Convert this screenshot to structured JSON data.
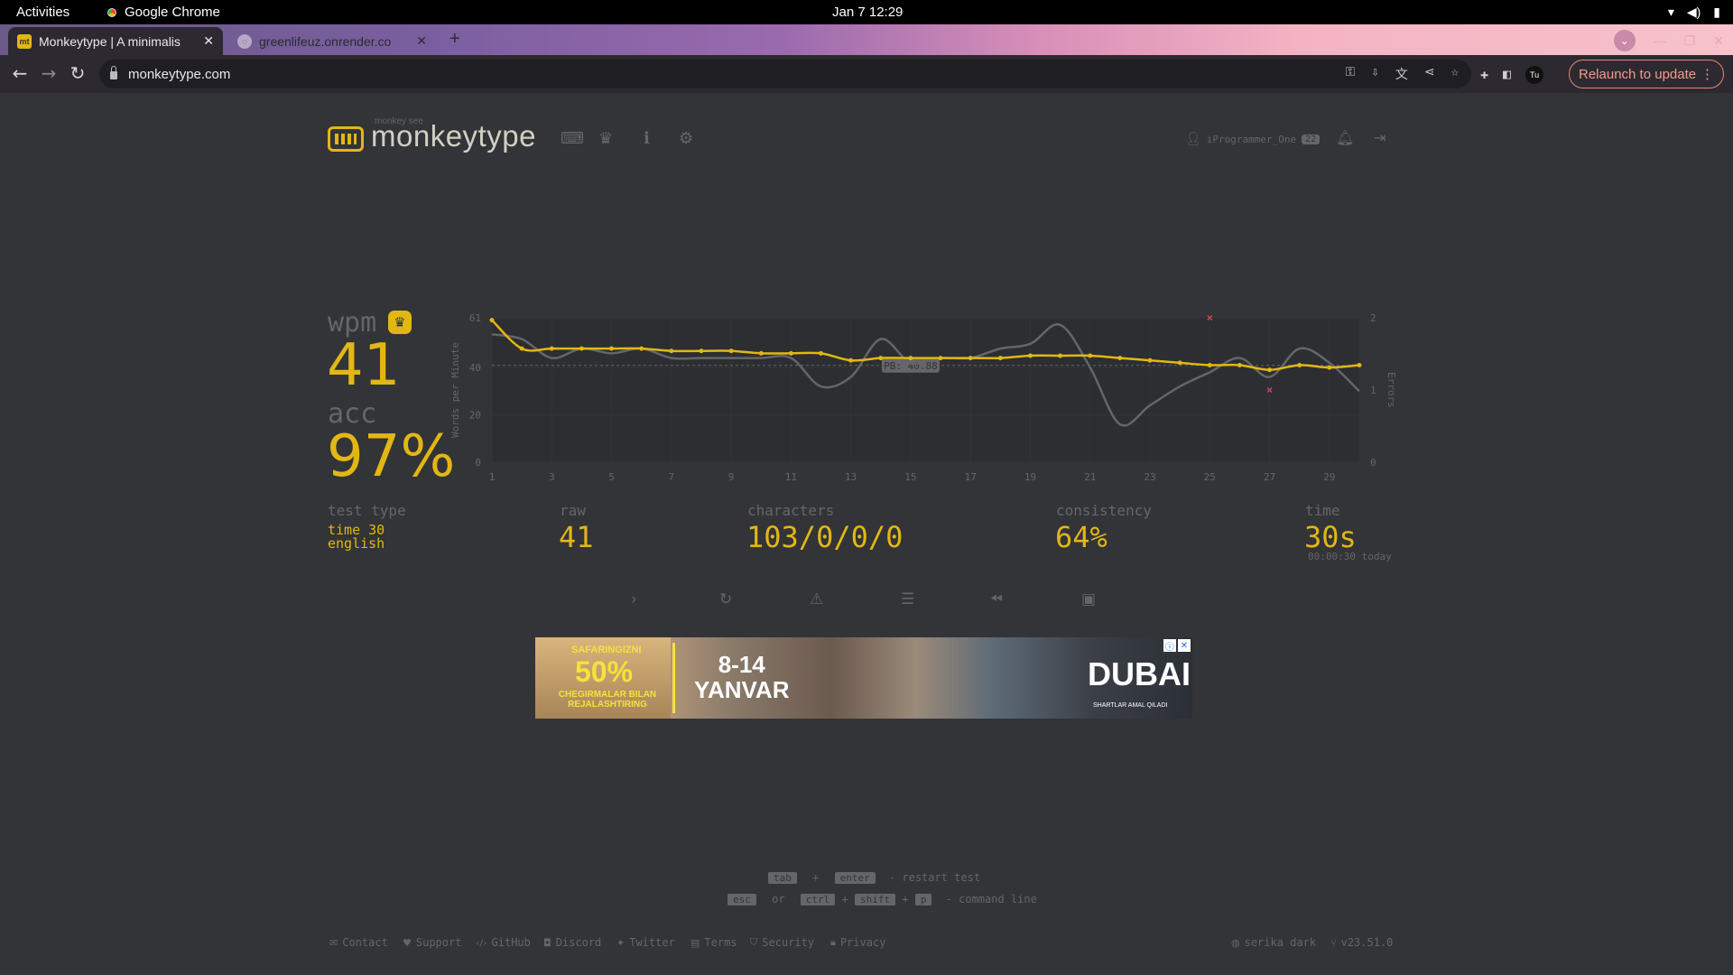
{
  "system": {
    "activities": "Activities",
    "app_name": "Google Chrome",
    "clock": "Jan 7  12:29",
    "tray_icons": [
      "wifi-icon",
      "volume-icon",
      "battery-icon"
    ]
  },
  "browser": {
    "tabs": [
      {
        "title": "Monkeytype | A minimalis",
        "favicon": "mt",
        "active": true
      },
      {
        "title": "greenlifeuz.onrender.co",
        "favicon": "",
        "active": false
      }
    ],
    "new_tab": "+",
    "url": "monkeytype.com",
    "relaunch_label": "Relaunch to update",
    "profile_initials": "Tu"
  },
  "header": {
    "logo_top": "monkey see",
    "logo_text": "monkeytype",
    "username": "iProgrammer_One",
    "level": "22"
  },
  "stats": {
    "wpm_label": "wpm",
    "wpm": "41",
    "acc_label": "acc",
    "acc": "97%",
    "test_type_label": "test type",
    "test_type_line1": "time 30",
    "test_type_line2": "english",
    "raw_label": "raw",
    "raw": "41",
    "characters_label": "characters",
    "characters": "103/0/0/0",
    "consistency_label": "consistency",
    "consistency": "64%",
    "time_label": "time",
    "time": "30s",
    "time_detail": "00:00:30 today"
  },
  "chart_data": {
    "type": "line",
    "ylabel": "Words per Minute",
    "y2label": "Errors",
    "x": [
      1,
      2,
      3,
      4,
      5,
      6,
      7,
      8,
      9,
      10,
      11,
      12,
      13,
      14,
      15,
      16,
      17,
      18,
      19,
      20,
      21,
      22,
      23,
      24,
      25,
      26,
      27,
      28,
      29,
      30
    ],
    "x_ticks": [
      1,
      3,
      5,
      7,
      9,
      11,
      13,
      15,
      17,
      19,
      21,
      23,
      25,
      27,
      29
    ],
    "y_ticks": [
      0,
      20,
      40,
      61
    ],
    "y2_ticks": [
      0,
      1,
      2
    ],
    "ylim": [
      0,
      61
    ],
    "y2lim": [
      0,
      2
    ],
    "pb_label": "PB: 40.88",
    "pb_value": 40.88,
    "series": [
      {
        "name": "wpm",
        "color": "#e2b714",
        "values": [
          60,
          48,
          48,
          48,
          48,
          48,
          47,
          47,
          47,
          46,
          46,
          46,
          43,
          44,
          44,
          44,
          44,
          44,
          45,
          45,
          45,
          44,
          43,
          42,
          41,
          41,
          39,
          41,
          40,
          41
        ]
      },
      {
        "name": "raw",
        "color": "#646669",
        "values": [
          54,
          52,
          44,
          48,
          46,
          48,
          44,
          44,
          44,
          44,
          44,
          32,
          36,
          52,
          42,
          44,
          44,
          48,
          50,
          58,
          40,
          16,
          24,
          32,
          38,
          44,
          36,
          48,
          42,
          30
        ]
      }
    ],
    "errors": [
      {
        "x": 25,
        "y": 2
      },
      {
        "x": 27,
        "y": 1
      }
    ]
  },
  "actions": [
    "next-test-icon",
    "restart-icon",
    "report-icon",
    "words-history-icon",
    "replay-icon",
    "screenshot-icon"
  ],
  "ad": {
    "line1": "SAFARINGIZNI",
    "line2": "50%",
    "line3": "CHEGIRMALAR BILAN REJALASHTIRING",
    "dates": "8-14",
    "month": "YANVAR",
    "brand": "DUBAI",
    "footnote": "SHARTLAR AMAL QILADI"
  },
  "hints": {
    "tab": "tab",
    "plus": "+",
    "enter": "enter",
    "restart": "- restart test",
    "esc": "esc",
    "or": "or",
    "ctrl": "ctrl",
    "shift": "shift",
    "p": "p",
    "command": "- command line"
  },
  "footer": {
    "links": [
      "Contact",
      "Support",
      "GitHub",
      "Discord",
      "Twitter",
      "Terms",
      "Security",
      "Privacy"
    ],
    "theme": "serika dark",
    "version": "v23.51.0"
  },
  "colors": {
    "bg": "#323437",
    "main": "#e2b714",
    "sub": "#646669",
    "text": "#d1d0c5",
    "error": "#ca4754"
  }
}
